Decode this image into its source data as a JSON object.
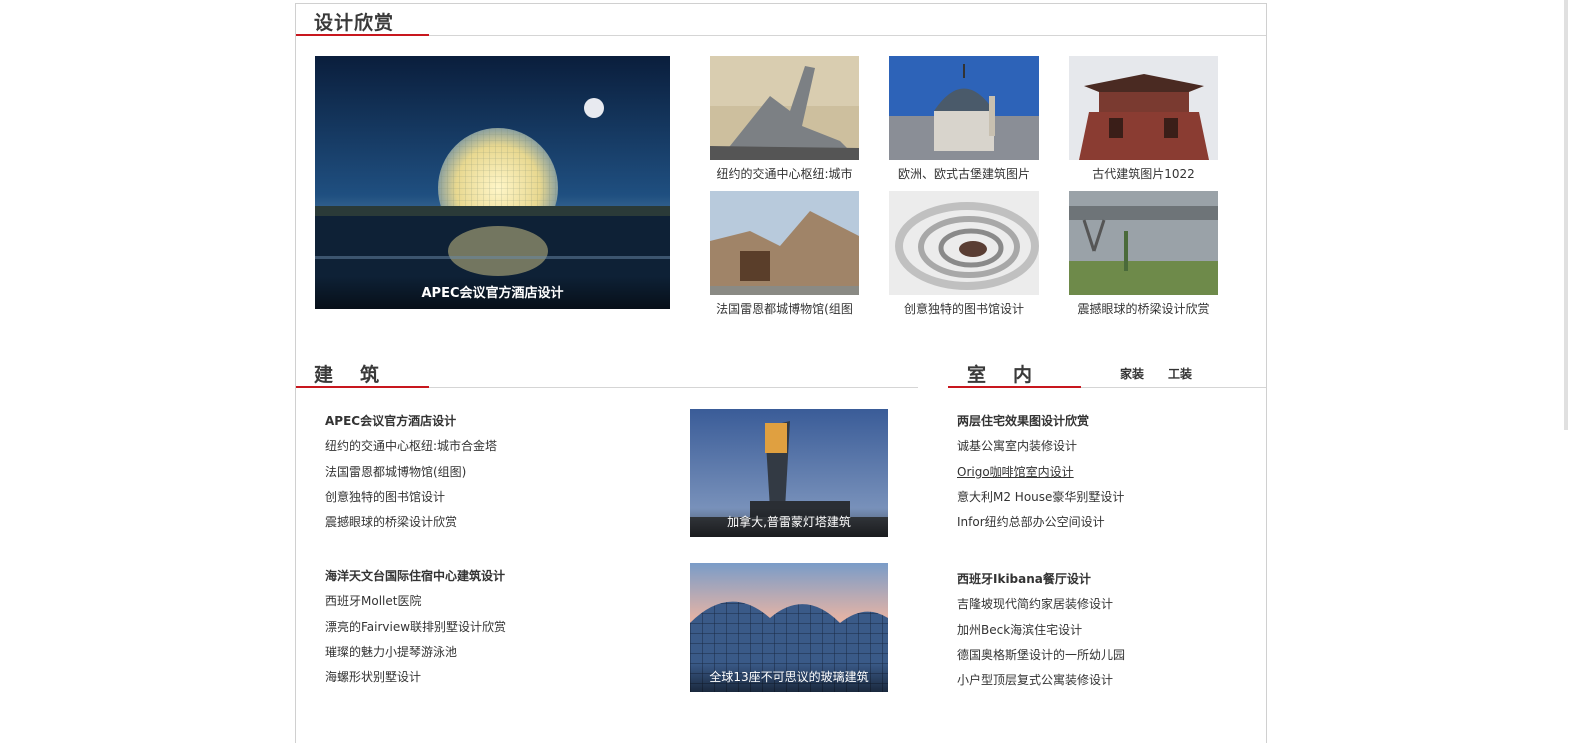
{
  "section_design": {
    "title": "设计欣赏",
    "featured": {
      "caption": "APEC会议官方酒店设计"
    },
    "thumbs": [
      {
        "caption": "纽约的交通中心枢纽:城市"
      },
      {
        "caption": "欧洲、欧式古堡建筑图片"
      },
      {
        "caption": "古代建筑图片1022"
      },
      {
        "caption": "法国雷恩都城博物馆(组图"
      },
      {
        "caption": "创意独特的图书馆设计"
      },
      {
        "caption": "震撼眼球的桥梁设计欣赏"
      }
    ]
  },
  "section_arch": {
    "title": "建　筑",
    "group1": {
      "items": [
        "APEC会议官方酒店设计",
        "纽约的交通中心枢纽:城市合金塔",
        "法国雷恩都城博物馆(组图)",
        "创意独特的图书馆设计",
        "震撼眼球的桥梁设计欣赏"
      ],
      "image_caption": "加拿大,普雷蒙灯塔建筑"
    },
    "group2": {
      "items": [
        "海洋天文台国际住宿中心建筑设计",
        "西班牙Mollet医院",
        "漂亮的Fairview联排别墅设计欣赏",
        "璀璨的魅力小提琴游泳池",
        "海螺形状别墅设计"
      ],
      "image_caption": "全球13座不可思议的玻璃建筑"
    }
  },
  "section_interior": {
    "title": "室　内",
    "tabs": [
      "家装",
      "工装"
    ],
    "group1": [
      "两层住宅效果图设计欣赏",
      "诚基公寓室内装修设计",
      "Origo咖啡馆室内设计",
      "意大利M2 House豪华别墅设计",
      "Infor纽约总部办公空间设计"
    ],
    "group2": [
      "西班牙Ikibana餐厅设计",
      "吉隆坡现代简约家居装修设计",
      "加州Beck海滨住宅设计",
      "德国奥格斯堡设计的一所幼儿园",
      "小户型顶层复式公寓装修设计"
    ]
  },
  "colors": {
    "accent": "#c8171e",
    "rule": "#d5d5d5"
  }
}
